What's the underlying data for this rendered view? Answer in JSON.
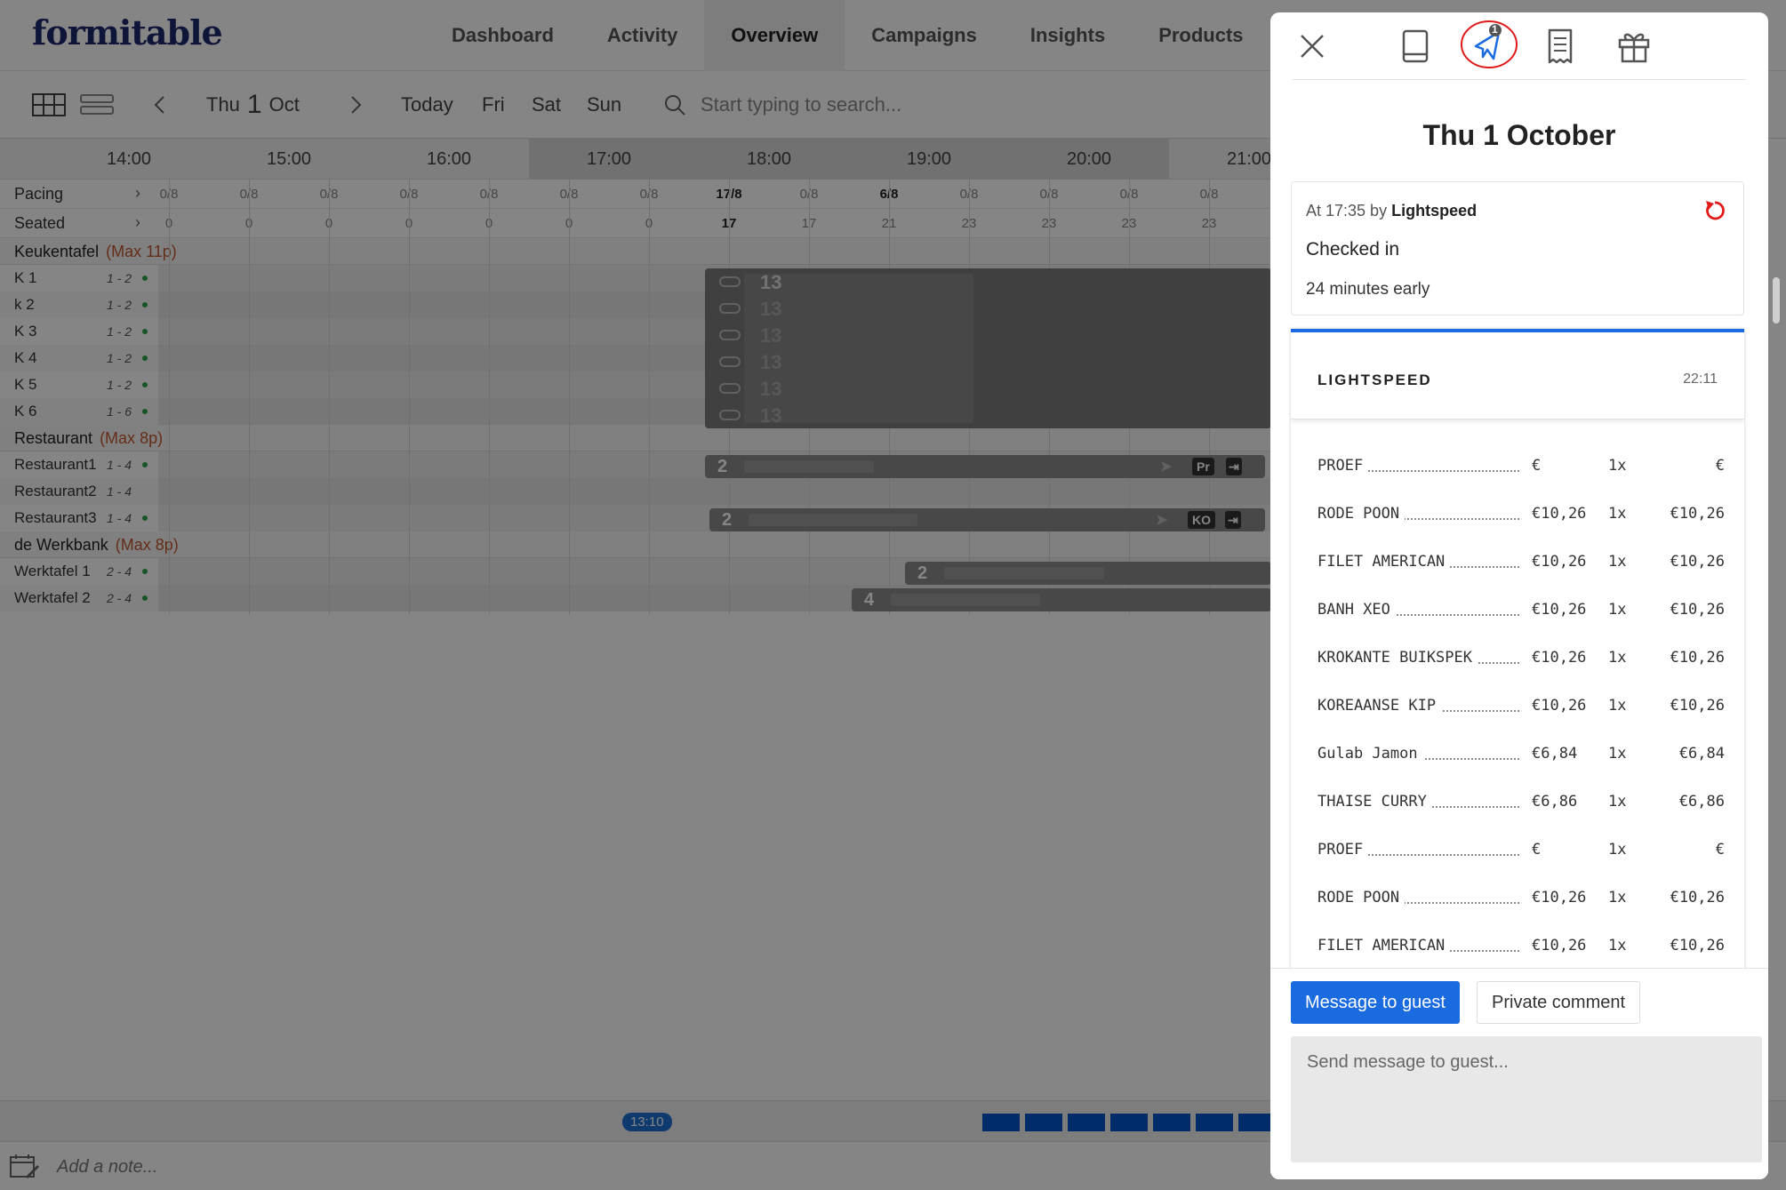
{
  "app": {
    "logo": "formitable",
    "nav": [
      "Dashboard",
      "Activity",
      "Overview",
      "Campaigns",
      "Insights",
      "Products"
    ],
    "active_nav": "Overview"
  },
  "toolbar": {
    "date_day": "Thu",
    "date_num": "1",
    "date_month": "Oct",
    "today": "Today",
    "quick_days": [
      "Fri",
      "Sat",
      "Sun"
    ],
    "search_placeholder": "Start typing to search..."
  },
  "timeline": {
    "hours": [
      "14:00",
      "15:00",
      "16:00",
      "17:00",
      "18:00",
      "19:00",
      "20:00",
      "21:00"
    ],
    "pacing_label": "Pacing",
    "seated_label": "Seated",
    "pacing": [
      "0/8",
      "0/8",
      "0/8",
      "0/8",
      "0/8",
      "0/8",
      "0/8",
      "17/8",
      "0/8",
      "6/8",
      "0/8",
      "0/8",
      "0/8",
      "0/8"
    ],
    "seated": [
      "0",
      "0",
      "0",
      "0",
      "0",
      "0",
      "0",
      "17",
      "17",
      "21",
      "23",
      "23",
      "23",
      "23"
    ]
  },
  "sections": [
    {
      "name": "Keukentafel",
      "max": "(Max 11p)",
      "tables": [
        {
          "name": "K 1",
          "cap": "1 - 2"
        },
        {
          "name": "k 2",
          "cap": "1 - 2"
        },
        {
          "name": "K 3",
          "cap": "1 - 2"
        },
        {
          "name": "K 4",
          "cap": "1 - 2"
        },
        {
          "name": "K 5",
          "cap": "1 - 2"
        },
        {
          "name": "K 6",
          "cap": "1 - 6"
        }
      ]
    },
    {
      "name": "Restaurant",
      "max": "(Max 8p)",
      "tables": [
        {
          "name": "Restaurant1",
          "cap": "1 - 4"
        },
        {
          "name": "Restaurant2",
          "cap": "1 - 4"
        },
        {
          "name": "Restaurant3",
          "cap": "1 - 4"
        }
      ]
    },
    {
      "name": "de Werkbank",
      "max": "(Max 8p)",
      "tables": [
        {
          "name": "Werktafel 1",
          "cap": "2 - 4"
        },
        {
          "name": "Werktafel 2",
          "cap": "2 - 4"
        }
      ]
    }
  ],
  "reservations": {
    "k_group_count": "13",
    "r1_count": "2",
    "r1_badge": "Pr",
    "r3_count": "2",
    "r3_badge": "KO",
    "w1_count": "2",
    "w2_count": "4"
  },
  "footer": {
    "current_time": "13:10",
    "note_placeholder": "Add a note..."
  },
  "panel": {
    "notification_count": "1",
    "title": "Thu 1 October",
    "event": {
      "time_prefix": "At 17:35 by",
      "by": "Lightspeed",
      "title": "Checked in",
      "detail": "24 minutes early"
    },
    "receipt": {
      "brand": "LIGHTSPEED",
      "time": "22:11",
      "items": [
        {
          "name": "PROEF",
          "price": "€",
          "qty": "1x",
          "total": "€"
        },
        {
          "name": "RODE POON",
          "price": "€10,26",
          "qty": "1x",
          "total": "€10,26"
        },
        {
          "name": "FILET AMERICAN",
          "price": "€10,26",
          "qty": "1x",
          "total": "€10,26"
        },
        {
          "name": "BANH XEO",
          "price": "€10,26",
          "qty": "1x",
          "total": "€10,26"
        },
        {
          "name": "KROKANTE BUIKSPEK",
          "price": "€10,26",
          "qty": "1x",
          "total": "€10,26"
        },
        {
          "name": "KOREAANSE KIP",
          "price": "€10,26",
          "qty": "1x",
          "total": "€10,26"
        },
        {
          "name": "Gulab Jamon",
          "price": "€6,84",
          "qty": "1x",
          "total": "€6,84"
        },
        {
          "name": "THAISE CURRY",
          "price": "€6,86",
          "qty": "1x",
          "total": "€6,86"
        },
        {
          "name": "PROEF",
          "price": "€",
          "qty": "1x",
          "total": "€"
        },
        {
          "name": "RODE POON",
          "price": "€10,26",
          "qty": "1x",
          "total": "€10,26"
        },
        {
          "name": "FILET AMERICAN",
          "price": "€10,26",
          "qty": "1x",
          "total": "€10,26"
        }
      ]
    },
    "message_button": "Message to guest",
    "private_button": "Private comment",
    "message_placeholder": "Send message to guest..."
  }
}
